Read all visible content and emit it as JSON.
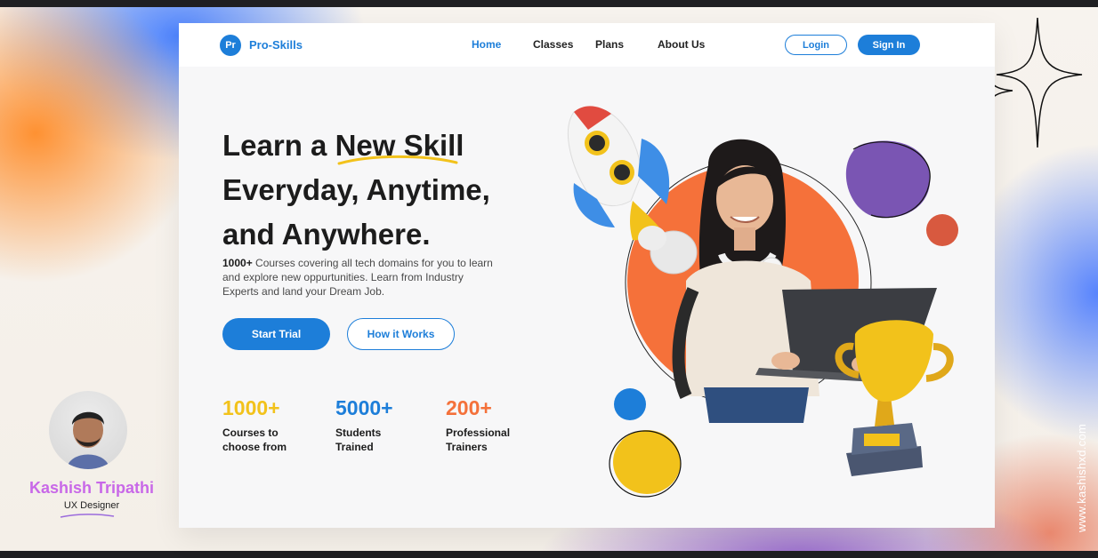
{
  "site": {
    "logo_badge": "Pr",
    "brand_name": "Pro-Skills"
  },
  "nav": {
    "links": [
      {
        "label": "Home",
        "active": true
      },
      {
        "label": "Classes",
        "active": false
      },
      {
        "label": "Plans",
        "active": false
      },
      {
        "label": "About Us",
        "active": false
      }
    ],
    "login_label": "Login",
    "signin_label": "Sign In"
  },
  "hero": {
    "headline_part1": "Learn a ",
    "headline_highlight": "New Skill",
    "headline_line2": "Everyday, Anytime,",
    "headline_line3": "and Anywhere.",
    "sub_bold": "1000+",
    "sub_text": " Courses covering all tech domains for you to learn and explore new oppurtunities. Learn from Industry Experts and land your Dream Job.",
    "primary_cta": "Start Trial",
    "secondary_cta": "How it Works"
  },
  "stats": [
    {
      "value": "1000+",
      "label_line1": "Courses to",
      "label_line2": "choose from",
      "color": "#f2c21b"
    },
    {
      "value": "5000+",
      "label_line1": "Students",
      "label_line2": "Trained",
      "color": "#1d7ed9"
    },
    {
      "value": "200+",
      "label_line1": "Professional",
      "label_line2": "Trainers",
      "color": "#f4713a"
    }
  ],
  "designer": {
    "name": "Kashish Tripathi",
    "role": "UX Designer",
    "website": "www.kashishxd.com"
  },
  "colors": {
    "primary": "#1d7ed9",
    "yellow": "#f2c21b",
    "orange": "#f4713a",
    "purple": "#7a55b3",
    "name_gradient": "#c868e8"
  },
  "illustration": {
    "icons": [
      "rocket-icon",
      "trophy-icon",
      "headphones-icon",
      "laptop-icon",
      "sparkle-icon"
    ]
  }
}
